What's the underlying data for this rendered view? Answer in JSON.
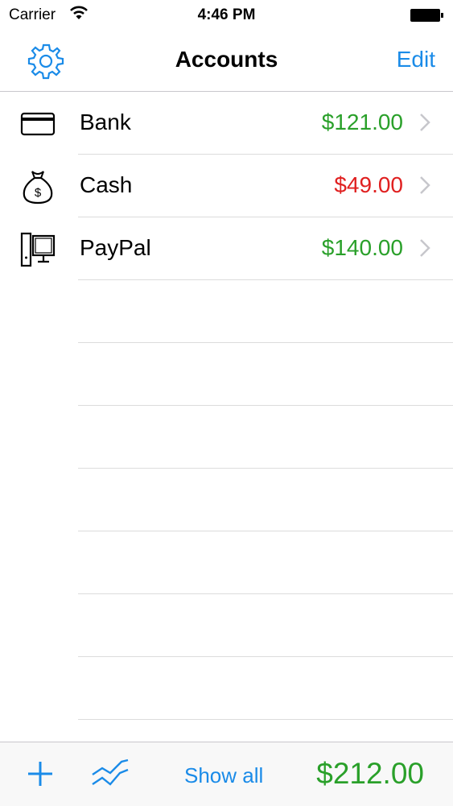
{
  "status_bar": {
    "carrier": "Carrier",
    "time": "4:46 PM"
  },
  "nav": {
    "title": "Accounts",
    "edit_label": "Edit"
  },
  "accounts": [
    {
      "name": "Bank",
      "amount": "$121.00",
      "amount_color": "#2aa02a",
      "icon": "credit-card-icon"
    },
    {
      "name": "Cash",
      "amount": "$49.00",
      "amount_color": "#e02020",
      "icon": "money-bag-icon"
    },
    {
      "name": "PayPal",
      "amount": "$140.00",
      "amount_color": "#2aa02a",
      "icon": "computer-icon"
    }
  ],
  "toolbar": {
    "show_all_label": "Show all",
    "total": "$212.00",
    "total_color": "#2aa02a"
  },
  "colors": {
    "accent": "#1a8be8",
    "positive": "#2aa02a",
    "negative": "#e02020"
  }
}
